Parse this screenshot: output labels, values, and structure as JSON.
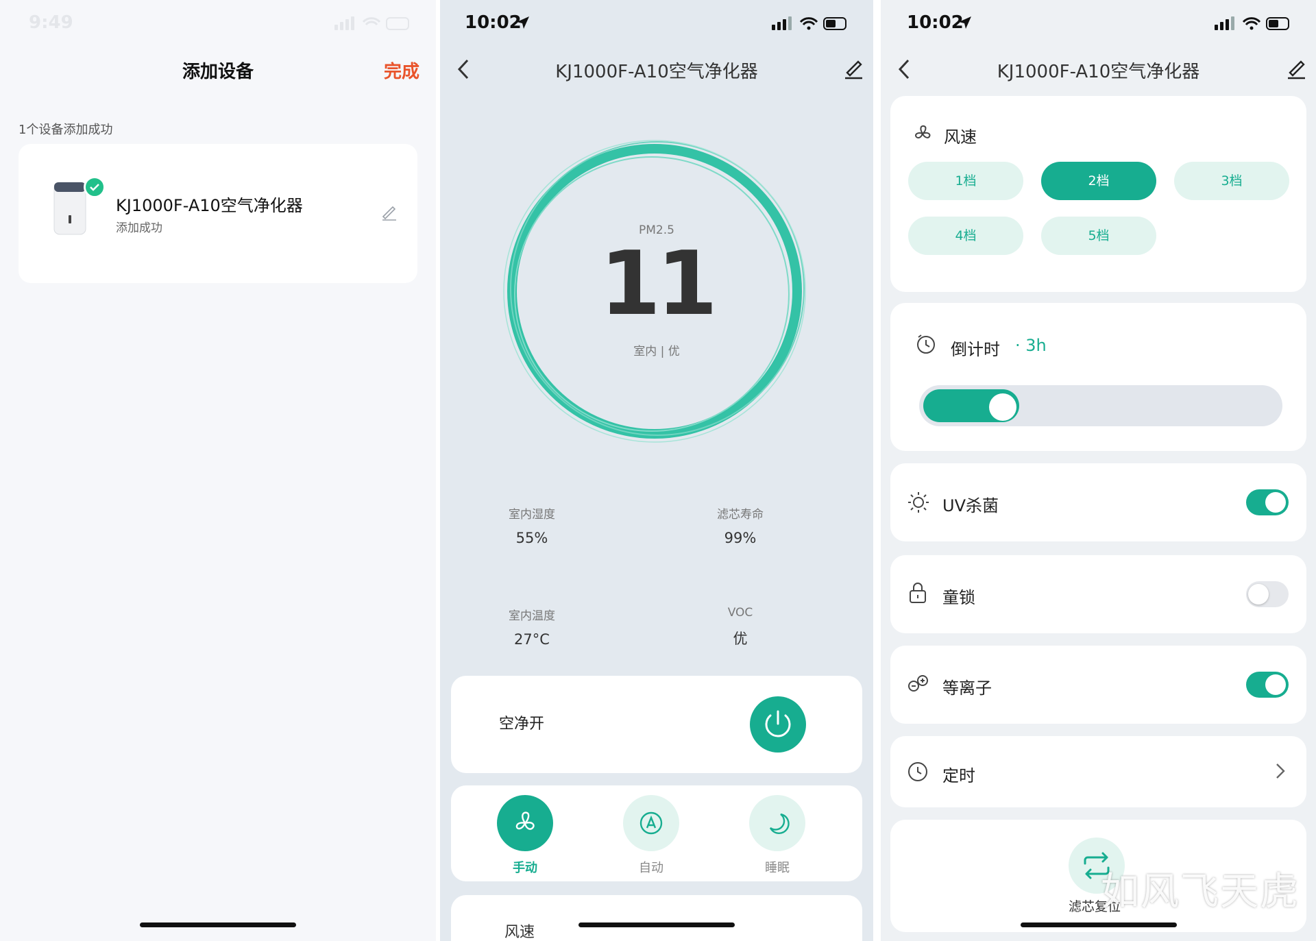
{
  "colors": {
    "accent": "#17ad90",
    "done": "#e9542b",
    "success_badge": "#22c08a"
  },
  "panel1": {
    "time": "9:49",
    "title": "添加设备",
    "done": "完成",
    "subtitle": "1个设备添加成功",
    "device": {
      "name": "KJ1000F-A10空气净化器",
      "status": "添加成功"
    }
  },
  "panel2": {
    "time": "10:02",
    "title": "KJ1000F-A10空气净化器",
    "pm_label": "PM2.5",
    "pm_value": "11",
    "pm_status": "室内 | 优",
    "stats": [
      {
        "label": "室内湿度",
        "value": "55%"
      },
      {
        "label": "滤芯寿命",
        "value": "99%"
      },
      {
        "label": "室内温度",
        "value": "27°C"
      },
      {
        "label": "VOC",
        "value": "优"
      }
    ],
    "power_label": "空净开",
    "modes": [
      {
        "label": "手动",
        "icon": "fan-icon",
        "active": true
      },
      {
        "label": "自动",
        "icon": "auto-icon",
        "active": false
      },
      {
        "label": "睡眠",
        "icon": "moon-icon",
        "active": false
      }
    ],
    "peek_label": "风速"
  },
  "panel3": {
    "time": "10:02",
    "title": "KJ1000F-A10空气净化器",
    "speed_title": "风速",
    "speeds": [
      "1档",
      "2档",
      "3档",
      "4档",
      "5档"
    ],
    "speed_selected": "2档",
    "countdown_label": "倒计时",
    "countdown_value": "· 3h",
    "countdown_fraction": 0.27,
    "uv_label": "UV杀菌",
    "uv_on": true,
    "lock_label": "童锁",
    "lock_on": false,
    "ion_label": "等离子",
    "ion_on": true,
    "timer_label": "定时",
    "reset_label": "滤芯复位",
    "watermark": "如风飞天虎"
  }
}
